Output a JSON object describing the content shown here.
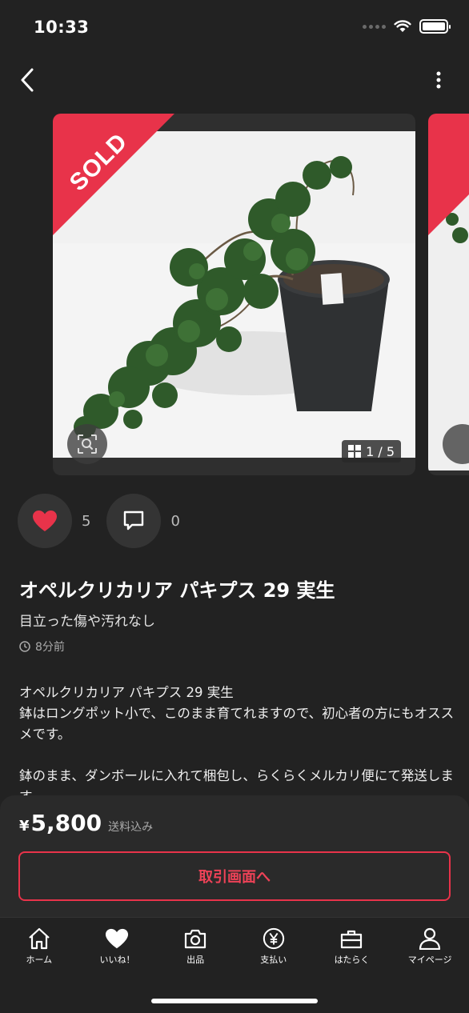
{
  "status_bar": {
    "time": "10:33"
  },
  "gallery": {
    "sold_label": "SOLD",
    "counter": "1 / 5",
    "icons": {
      "back": "chevron-left-icon",
      "more": "more-vertical-icon",
      "lens": "image-search-icon",
      "grid": "grid-icon"
    }
  },
  "actions": {
    "like_count": "5",
    "comment_count": "0",
    "like_color": "#e8334a"
  },
  "item": {
    "title": "オペルクリカリア パキプス 29 実生",
    "condition": "目立った傷や汚れなし",
    "posted": "8分前",
    "description_lines": [
      "オペルクリカリア パキプス 29 実生",
      "鉢はロングポット小で、このまま育てれますので、初心者の方にもオススメです。",
      "鉢のまま、ダンボールに入れて梱包し、らくらくメルカリ便にて発送します。"
    ]
  },
  "purchase": {
    "currency": "¥",
    "price": "5,800",
    "shipping_note": "送料込み",
    "button_label": "取引画面へ",
    "accent_color": "#e8334a"
  },
  "tabbar": {
    "items": [
      {
        "label": "ホーム",
        "icon": "home-icon"
      },
      {
        "label": "いいね！",
        "icon": "heart-icon"
      },
      {
        "label": "出品",
        "icon": "camera-icon"
      },
      {
        "label": "支払い",
        "icon": "yen-icon"
      },
      {
        "label": "はたらく",
        "icon": "briefcase-icon"
      },
      {
        "label": "マイページ",
        "icon": "person-icon"
      }
    ]
  }
}
